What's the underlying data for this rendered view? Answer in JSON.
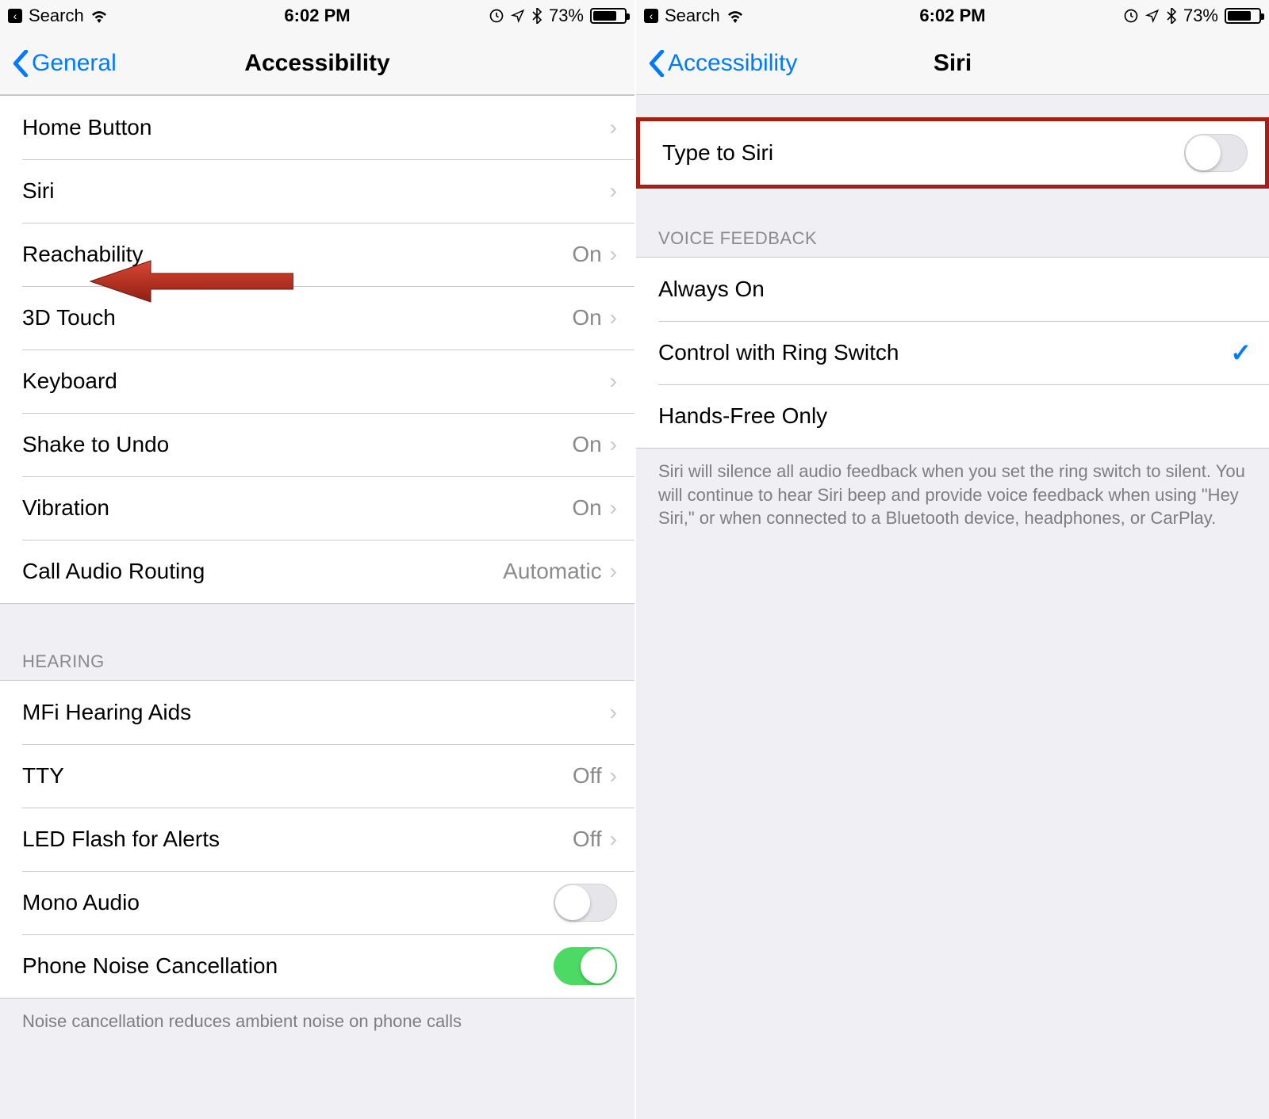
{
  "statusbar": {
    "back_text": "Search",
    "time": "6:02 PM",
    "battery_pct": "73%"
  },
  "left": {
    "nav": {
      "back": "General",
      "title": "Accessibility"
    },
    "section1": {
      "items": [
        {
          "label": "Home Button",
          "detail": ""
        },
        {
          "label": "Siri",
          "detail": ""
        },
        {
          "label": "Reachability",
          "detail": "On"
        },
        {
          "label": "3D Touch",
          "detail": "On"
        },
        {
          "label": "Keyboard",
          "detail": ""
        },
        {
          "label": "Shake to Undo",
          "detail": "On"
        },
        {
          "label": "Vibration",
          "detail": "On"
        },
        {
          "label": "Call Audio Routing",
          "detail": "Automatic"
        }
      ]
    },
    "hearing_header": "Hearing",
    "section2": {
      "items": [
        {
          "label": "MFi Hearing Aids",
          "detail": ""
        },
        {
          "label": "TTY",
          "detail": "Off"
        },
        {
          "label": "LED Flash for Alerts",
          "detail": "Off"
        },
        {
          "label": "Mono Audio"
        },
        {
          "label": "Phone Noise Cancellation"
        }
      ]
    },
    "noise_footer": "Noise cancellation reduces ambient noise on phone calls"
  },
  "right": {
    "nav": {
      "back": "Accessibility",
      "title": "Siri"
    },
    "type_to_siri": "Type to Siri",
    "voice_feedback_header": "Voice Feedback",
    "voice_feedback": {
      "items": [
        {
          "label": "Always On",
          "checked": false
        },
        {
          "label": "Control with Ring Switch",
          "checked": true
        },
        {
          "label": "Hands-Free Only",
          "checked": false
        }
      ]
    },
    "voice_feedback_footer": "Siri will silence all audio feedback when you set the ring switch to silent. You will continue to hear Siri beep and provide voice feedback when using \"Hey Siri,\" or when connected to a Bluetooth device, headphones, or CarPlay."
  }
}
